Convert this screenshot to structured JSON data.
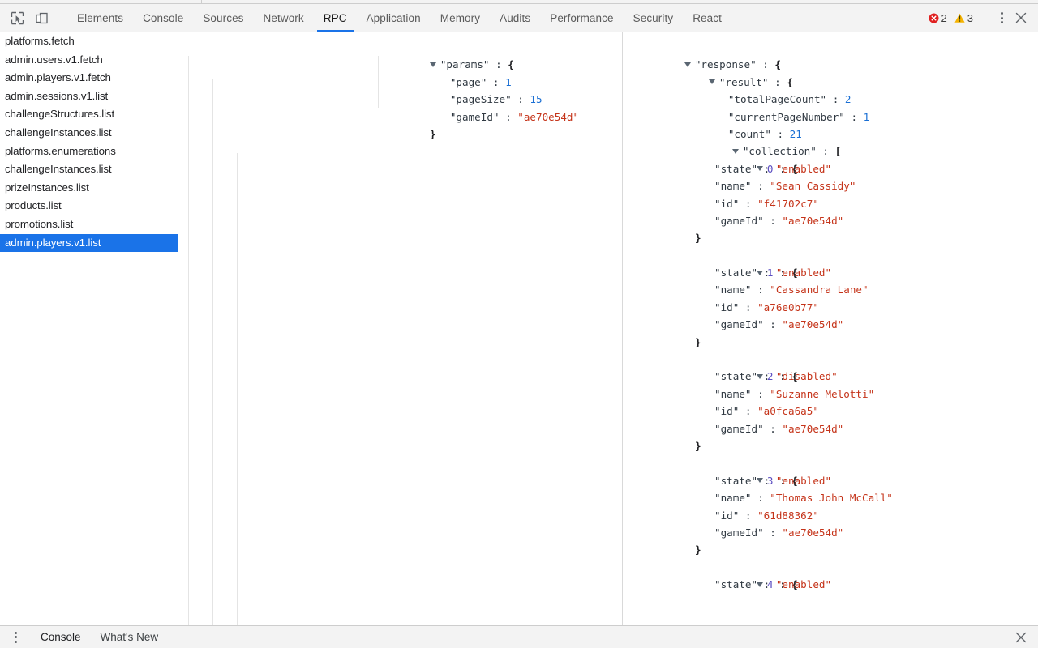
{
  "toolbar": {
    "inspect_icon": "cursor-select-icon",
    "device_icon": "device-toolbar-icon",
    "tabs": [
      {
        "label": "Elements",
        "active": false
      },
      {
        "label": "Console",
        "active": false
      },
      {
        "label": "Sources",
        "active": false
      },
      {
        "label": "Network",
        "active": false
      },
      {
        "label": "RPC",
        "active": true
      },
      {
        "label": "Application",
        "active": false
      },
      {
        "label": "Memory",
        "active": false
      },
      {
        "label": "Audits",
        "active": false
      },
      {
        "label": "Performance",
        "active": false
      },
      {
        "label": "Security",
        "active": false
      },
      {
        "label": "React",
        "active": false
      }
    ],
    "error_count": "2",
    "warning_count": "3",
    "error_color": "#e02020",
    "warning_color": "#f5b300",
    "accent_color": "#1a73e8",
    "more_label": "more-options",
    "close_label": "×"
  },
  "sidebar": {
    "items": [
      {
        "label": "platforms.fetch",
        "selected": false
      },
      {
        "label": "admin.users.v1.fetch",
        "selected": false
      },
      {
        "label": "admin.players.v1.fetch",
        "selected": false
      },
      {
        "label": "admin.sessions.v1.list",
        "selected": false
      },
      {
        "label": "challengeStructures.list",
        "selected": false
      },
      {
        "label": "challengeInstances.list",
        "selected": false
      },
      {
        "label": "platforms.enumerations",
        "selected": false
      },
      {
        "label": "challengeInstances.list",
        "selected": false
      },
      {
        "label": "prizeInstances.list",
        "selected": false
      },
      {
        "label": "products.list",
        "selected": false
      },
      {
        "label": "promotions.list",
        "selected": false
      },
      {
        "label": "admin.players.v1.list",
        "selected": true
      }
    ]
  },
  "params_panel": {
    "root_key": "\"params\"",
    "entries": [
      {
        "key": "\"page\"",
        "value": "1",
        "type": "num"
      },
      {
        "key": "\"pageSize\"",
        "value": "15",
        "type": "num"
      },
      {
        "key": "\"gameId\"",
        "value": "\"ae70e54d\"",
        "type": "str"
      }
    ],
    "close_brace": "}"
  },
  "response_panel": {
    "root_key": "\"response\"",
    "result_key": "\"result\"",
    "scalars": [
      {
        "key": "\"totalPageCount\"",
        "value": "2",
        "type": "num"
      },
      {
        "key": "\"currentPageNumber\"",
        "value": "1",
        "type": "num"
      },
      {
        "key": "\"count\"",
        "value": "21",
        "type": "num"
      }
    ],
    "collection_key": "\"collection\"",
    "collection": [
      {
        "index": "0",
        "fields": [
          {
            "key": "\"state\"",
            "value": "\"enabled\""
          },
          {
            "key": "\"name\"",
            "value": "\"Sean Cassidy\""
          },
          {
            "key": "\"id\"",
            "value": "\"f41702c7\""
          },
          {
            "key": "\"gameId\"",
            "value": "\"ae70e54d\""
          }
        ]
      },
      {
        "index": "1",
        "fields": [
          {
            "key": "\"state\"",
            "value": "\"enabled\""
          },
          {
            "key": "\"name\"",
            "value": "\"Cassandra Lane\""
          },
          {
            "key": "\"id\"",
            "value": "\"a76e0b77\""
          },
          {
            "key": "\"gameId\"",
            "value": "\"ae70e54d\""
          }
        ]
      },
      {
        "index": "2",
        "fields": [
          {
            "key": "\"state\"",
            "value": "\"disabled\""
          },
          {
            "key": "\"name\"",
            "value": "\"Suzanne Melotti\""
          },
          {
            "key": "\"id\"",
            "value": "\"a0fca6a5\""
          },
          {
            "key": "\"gameId\"",
            "value": "\"ae70e54d\""
          }
        ]
      },
      {
        "index": "3",
        "fields": [
          {
            "key": "\"state\"",
            "value": "\"enabled\""
          },
          {
            "key": "\"name\"",
            "value": "\"Thomas John McCall\""
          },
          {
            "key": "\"id\"",
            "value": "\"61d88362\""
          },
          {
            "key": "\"gameId\"",
            "value": "\"ae70e54d\""
          }
        ]
      },
      {
        "index": "4",
        "fields": [
          {
            "key": "\"state\"",
            "value": "\"enabled\""
          }
        ]
      }
    ],
    "close_brace": "}",
    "open_brace": "{",
    "open_bracket": "[",
    "colon": ":"
  },
  "drawer": {
    "menu_icon": "kebab-menu-icon",
    "tabs": [
      {
        "label": "Console"
      },
      {
        "label": "What's New"
      }
    ],
    "close_label": "×"
  }
}
